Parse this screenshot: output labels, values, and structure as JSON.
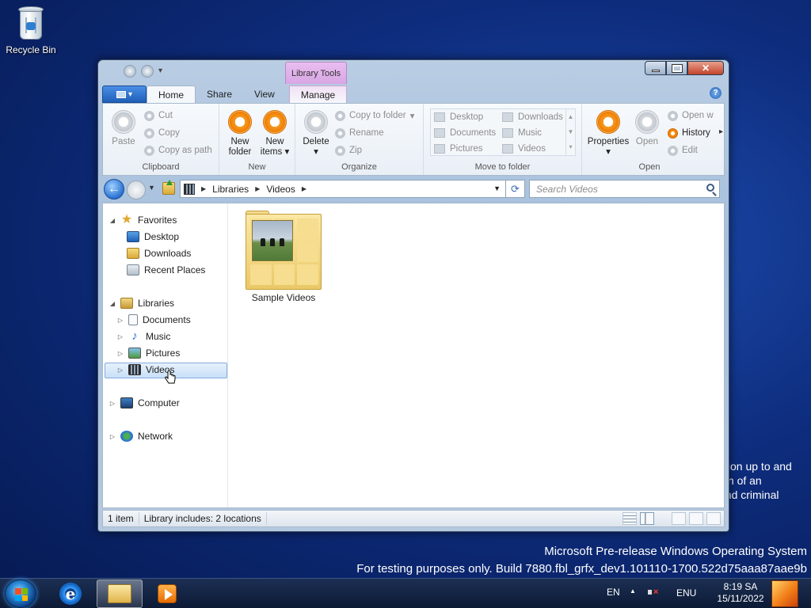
{
  "desktop": {
    "recycle_bin_label": "Recycle Bin",
    "background_text": [
      "ction up to and",
      "ion of an",
      "and criminal"
    ],
    "watermark_line1": "Microsoft Pre-release Windows Operating System",
    "watermark_line2": "For testing purposes only. Build 7880.fbl_grfx_dev1.101110-1700.522d75aaa87aae9b"
  },
  "window": {
    "contextual_tab_group": "Library Tools",
    "tabs": [
      "Home",
      "Share",
      "View",
      "Manage"
    ],
    "active_tab": "Home",
    "help_glyph": "?"
  },
  "ribbon": {
    "clipboard": {
      "label": "Clipboard",
      "paste": "Paste",
      "cut": "Cut",
      "copy": "Copy",
      "copy_as_path": "Copy as path"
    },
    "new": {
      "label": "New",
      "new_folder_line1": "New",
      "new_folder_line2": "folder",
      "new_items_line1": "New",
      "new_items_line2": "items"
    },
    "organize": {
      "label": "Organize",
      "delete": "Delete",
      "copy_to_folder": "Copy to folder",
      "rename": "Rename",
      "zip": "Zip"
    },
    "move_to_folder": {
      "label": "Move to folder",
      "items": [
        "Desktop",
        "Downloads",
        "Documents",
        "Music",
        "Pictures",
        "Videos"
      ]
    },
    "open": {
      "label": "Open",
      "properties": "Properties",
      "open": "Open",
      "open_with": "Open w",
      "history": "History",
      "edit": "Edit"
    }
  },
  "address": {
    "crumbs": [
      "Libraries",
      "Videos"
    ],
    "search_placeholder": "Search Videos"
  },
  "nav_tree": {
    "favorites": "Favorites",
    "favorites_items": [
      "Desktop",
      "Downloads",
      "Recent Places"
    ],
    "libraries": "Libraries",
    "libraries_items": [
      "Documents",
      "Music",
      "Pictures",
      "Videos"
    ],
    "selected": "Videos",
    "computer": "Computer",
    "network": "Network"
  },
  "content": {
    "items": [
      {
        "name": "Sample Videos",
        "type": "folder"
      }
    ]
  },
  "statusbar": {
    "item_count": "1 item",
    "library_info": "Library includes:  2 locations"
  },
  "taskbar": {
    "language": "EN",
    "input": "ENU",
    "time": "8:19 SA",
    "date": "15/11/2022"
  }
}
